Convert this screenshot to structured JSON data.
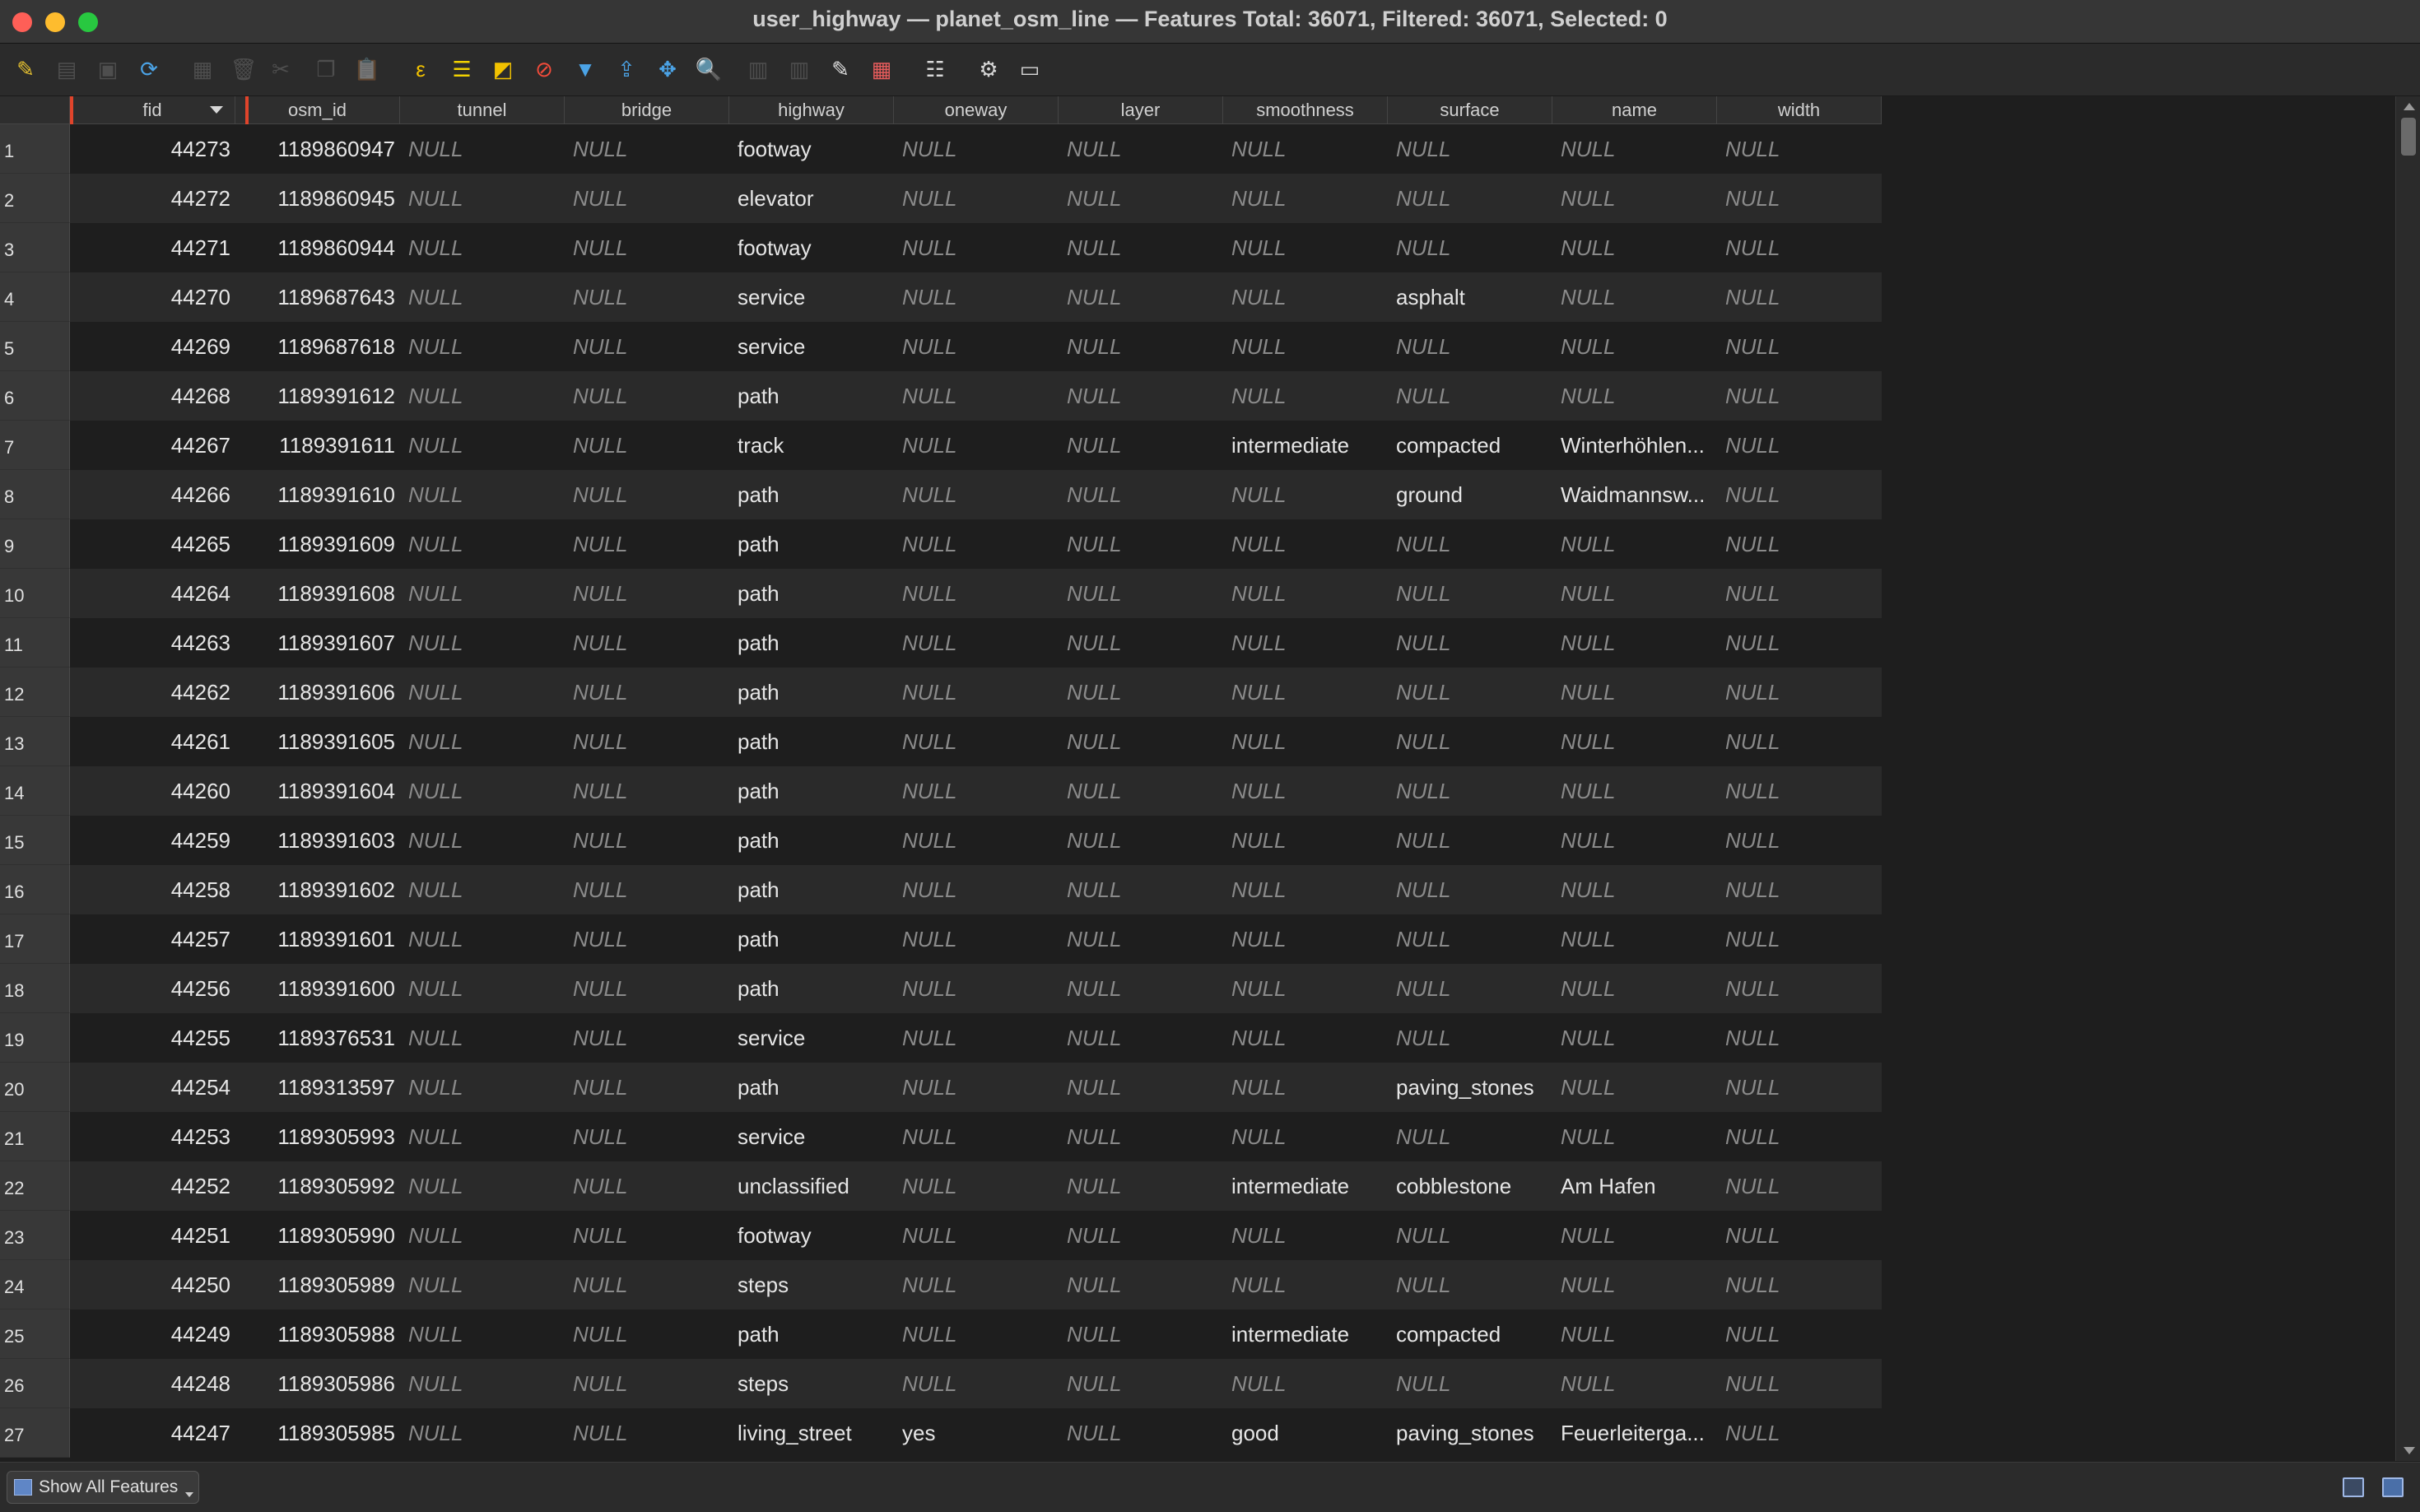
{
  "window": {
    "title": "user_highway — planet_osm_line — Features Total: 36071, Filtered: 36071, Selected: 0"
  },
  "toolbar": {
    "items": [
      {
        "name": "toggle-editing-icon",
        "glyph": "✎",
        "color": "#e8c330"
      },
      {
        "name": "multi-edit-icon",
        "glyph": "▤",
        "color": "#8f8f8f"
      },
      {
        "name": "save-edits-icon",
        "glyph": "▣",
        "color": "#8f8f8f"
      },
      {
        "name": "reload-icon",
        "glyph": "⟳",
        "color": "#4ba3e6"
      },
      {
        "name": "add-feature-icon",
        "glyph": "▦",
        "color": "#8f8f8f"
      },
      {
        "name": "delete-feature-icon",
        "glyph": "🗑",
        "color": "#8f8f8f"
      },
      {
        "name": "cut-icon",
        "glyph": "✂",
        "color": "#8f8f8f"
      },
      {
        "name": "copy-icon",
        "glyph": "❐",
        "color": "#8f8f8f"
      },
      {
        "name": "paste-icon",
        "glyph": "📋",
        "color": "#8f8f8f"
      },
      {
        "name": "select-by-expression-icon",
        "glyph": "ε",
        "color": "#f2c200"
      },
      {
        "name": "select-all-icon",
        "glyph": "☰",
        "color": "#f2d200"
      },
      {
        "name": "invert-selection-icon",
        "glyph": "◩",
        "color": "#f2c200"
      },
      {
        "name": "deselect-all-icon",
        "glyph": "⊘",
        "color": "#f24b3a"
      },
      {
        "name": "filter-select-icon",
        "glyph": "▼",
        "color": "#4ba3e6"
      },
      {
        "name": "move-selection-top-icon",
        "glyph": "⇪",
        "color": "#4ba3e6"
      },
      {
        "name": "pan-to-selected-icon",
        "glyph": "✥",
        "color": "#4ba3e6"
      },
      {
        "name": "zoom-to-selected-icon",
        "glyph": "🔍",
        "color": "#d8d8d8"
      },
      {
        "name": "new-field-icon",
        "glyph": "▥",
        "color": "#8f8f8f"
      },
      {
        "name": "delete-field-icon",
        "glyph": "▥",
        "color": "#8f8f8f"
      },
      {
        "name": "field-calculator-icon",
        "glyph": "✎",
        "color": "#e0e0e0"
      },
      {
        "name": "conditional-formatting-icon",
        "glyph": "▦",
        "color": "#e65c5c"
      },
      {
        "name": "dock-icon",
        "glyph": "☷",
        "color": "#d8d8d8"
      },
      {
        "name": "actions-icon",
        "glyph": "⚙",
        "color": "#d8d8d8"
      },
      {
        "name": "organize-columns-icon",
        "glyph": "▭",
        "color": "#d8d8d8"
      }
    ]
  },
  "table": {
    "columns": [
      {
        "key": "fid",
        "label": "fid",
        "type": "num"
      },
      {
        "key": "osm_id",
        "label": "osm_id",
        "type": "num"
      },
      {
        "key": "tunnel",
        "label": "tunnel",
        "type": "txt"
      },
      {
        "key": "bridge",
        "label": "bridge",
        "type": "txt"
      },
      {
        "key": "highway",
        "label": "highway",
        "type": "txt"
      },
      {
        "key": "oneway",
        "label": "oneway",
        "type": "txt"
      },
      {
        "key": "layer",
        "label": "layer",
        "type": "txt"
      },
      {
        "key": "smoothness",
        "label": "smoothness",
        "type": "txt"
      },
      {
        "key": "surface",
        "label": "surface",
        "type": "txt"
      },
      {
        "key": "name",
        "label": "name",
        "type": "txt"
      },
      {
        "key": "width",
        "label": "width",
        "type": "txt"
      }
    ],
    "null_text": "NULL",
    "rows": [
      [
        "1",
        "44273",
        "1189860947",
        null,
        null,
        "footway",
        null,
        null,
        null,
        null,
        null,
        null
      ],
      [
        "2",
        "44272",
        "1189860945",
        null,
        null,
        "elevator",
        null,
        null,
        null,
        null,
        null,
        null
      ],
      [
        "3",
        "44271",
        "1189860944",
        null,
        null,
        "footway",
        null,
        null,
        null,
        null,
        null,
        null
      ],
      [
        "4",
        "44270",
        "1189687643",
        null,
        null,
        "service",
        null,
        null,
        null,
        "asphalt",
        null,
        null
      ],
      [
        "5",
        "44269",
        "1189687618",
        null,
        null,
        "service",
        null,
        null,
        null,
        null,
        null,
        null
      ],
      [
        "6",
        "44268",
        "1189391612",
        null,
        null,
        "path",
        null,
        null,
        null,
        null,
        null,
        null
      ],
      [
        "7",
        "44267",
        "1189391611",
        null,
        null,
        "track",
        null,
        null,
        "intermediate",
        "compacted",
        "Winterhöhlen...",
        null
      ],
      [
        "8",
        "44266",
        "1189391610",
        null,
        null,
        "path",
        null,
        null,
        null,
        "ground",
        "Waidmannsw...",
        null
      ],
      [
        "9",
        "44265",
        "1189391609",
        null,
        null,
        "path",
        null,
        null,
        null,
        null,
        null,
        null
      ],
      [
        "10",
        "44264",
        "1189391608",
        null,
        null,
        "path",
        null,
        null,
        null,
        null,
        null,
        null
      ],
      [
        "11",
        "44263",
        "1189391607",
        null,
        null,
        "path",
        null,
        null,
        null,
        null,
        null,
        null
      ],
      [
        "12",
        "44262",
        "1189391606",
        null,
        null,
        "path",
        null,
        null,
        null,
        null,
        null,
        null
      ],
      [
        "13",
        "44261",
        "1189391605",
        null,
        null,
        "path",
        null,
        null,
        null,
        null,
        null,
        null
      ],
      [
        "14",
        "44260",
        "1189391604",
        null,
        null,
        "path",
        null,
        null,
        null,
        null,
        null,
        null
      ],
      [
        "15",
        "44259",
        "1189391603",
        null,
        null,
        "path",
        null,
        null,
        null,
        null,
        null,
        null
      ],
      [
        "16",
        "44258",
        "1189391602",
        null,
        null,
        "path",
        null,
        null,
        null,
        null,
        null,
        null
      ],
      [
        "17",
        "44257",
        "1189391601",
        null,
        null,
        "path",
        null,
        null,
        null,
        null,
        null,
        null
      ],
      [
        "18",
        "44256",
        "1189391600",
        null,
        null,
        "path",
        null,
        null,
        null,
        null,
        null,
        null
      ],
      [
        "19",
        "44255",
        "1189376531",
        null,
        null,
        "service",
        null,
        null,
        null,
        null,
        null,
        null
      ],
      [
        "20",
        "44254",
        "1189313597",
        null,
        null,
        "path",
        null,
        null,
        null,
        "paving_stones",
        null,
        null
      ],
      [
        "21",
        "44253",
        "1189305993",
        null,
        null,
        "service",
        null,
        null,
        null,
        null,
        null,
        null
      ],
      [
        "22",
        "44252",
        "1189305992",
        null,
        null,
        "unclassified",
        null,
        null,
        "intermediate",
        "cobblestone",
        "Am Hafen",
        null
      ],
      [
        "23",
        "44251",
        "1189305990",
        null,
        null,
        "footway",
        null,
        null,
        null,
        null,
        null,
        null
      ],
      [
        "24",
        "44250",
        "1189305989",
        null,
        null,
        "steps",
        null,
        null,
        null,
        null,
        null,
        null
      ],
      [
        "25",
        "44249",
        "1189305988",
        null,
        null,
        "path",
        null,
        null,
        "intermediate",
        "compacted",
        null,
        null
      ],
      [
        "26",
        "44248",
        "1189305986",
        null,
        null,
        "steps",
        null,
        null,
        null,
        null,
        null,
        null
      ],
      [
        "27",
        "44247",
        "1189305985",
        null,
        null,
        "living_street",
        "yes",
        null,
        "good",
        "paving_stones",
        "Feuerleiterga...",
        null
      ]
    ]
  },
  "footer": {
    "show_all_label": "Show All Features"
  },
  "colors": {
    "highlight": "#e0442b",
    "null_text": "#8a8a8a"
  }
}
